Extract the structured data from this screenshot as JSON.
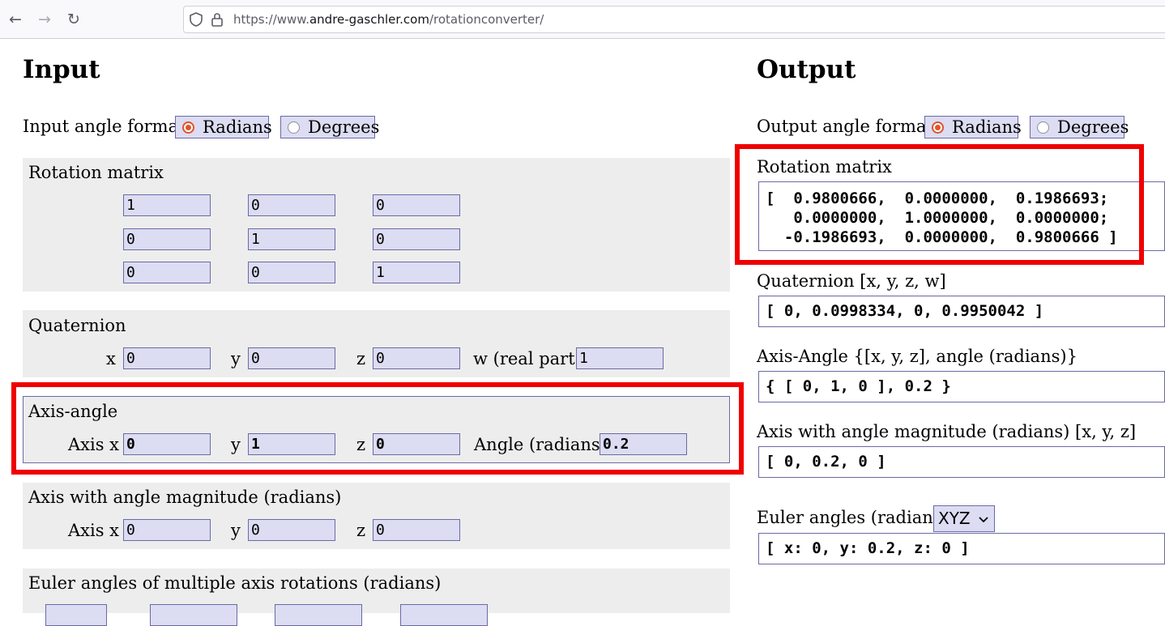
{
  "browser": {
    "back_icon": "←",
    "forward_icon": "→",
    "reload_icon": "↻",
    "url_prefix": "https://www.",
    "url_host": "andre-gaschler.com",
    "url_path": "/rotationconverter/"
  },
  "input": {
    "heading": "Input",
    "angle_format_label": "Input angle format",
    "radians_label": "Radians",
    "degrees_label": "Degrees",
    "selected_format": "Radians",
    "rotation_matrix": {
      "title": "Rotation matrix",
      "rows": [
        [
          "1",
          "0",
          "0"
        ],
        [
          "0",
          "1",
          "0"
        ],
        [
          "0",
          "0",
          "1"
        ]
      ]
    },
    "quaternion": {
      "title": "Quaternion",
      "x_label": "x",
      "y_label": "y",
      "z_label": "z",
      "w_label": "w (real part)",
      "x": "0",
      "y": "0",
      "z": "0",
      "w": "1"
    },
    "axis_angle": {
      "title": "Axis-angle",
      "x_label": "Axis x",
      "y_label": "y",
      "z_label": "z",
      "angle_label": "Angle (radians)",
      "x": "0",
      "y": "1",
      "z": "0",
      "angle": "0.2"
    },
    "axis_magnitude": {
      "title": "Axis with angle magnitude (radians)",
      "x_label": "Axis x",
      "y_label": "y",
      "z_label": "z",
      "x": "0",
      "y": "0",
      "z": "0"
    },
    "euler_multi": {
      "title": "Euler angles of multiple axis rotations (radians)"
    }
  },
  "output": {
    "heading": "Output",
    "angle_format_label": "Output angle format",
    "radians_label": "Radians",
    "degrees_label": "Degrees",
    "selected_format": "Radians",
    "rotation_matrix": {
      "title": "Rotation matrix",
      "lines": [
        "[  0.9800666,  0.0000000,  0.1986693;",
        "   0.0000000,  1.0000000,  0.0000000;",
        "  -0.1986693,  0.0000000,  0.9800666 ]"
      ]
    },
    "quaternion": {
      "title": "Quaternion [x, y, z, w]",
      "value": "[ 0, 0.0998334, 0, 0.9950042 ]"
    },
    "axis_angle": {
      "title": "Axis-Angle {[x, y, z], angle (radians)}",
      "value": "{ [ 0, 1, 0 ], 0.2 }"
    },
    "axis_magnitude": {
      "title": "Axis with angle magnitude (radians) [x, y, z]",
      "value": "[ 0, 0.2, 0 ]"
    },
    "euler": {
      "title": "Euler angles (radians)",
      "order": "XYZ",
      "value": "[ x: 0, y: 0.2, z: 0 ]"
    }
  },
  "colors": {
    "highlight": "#ef0000",
    "field_bg": "#dcdcf2",
    "panel_bg": "#ededed",
    "radio_accent": "#e0542c"
  }
}
